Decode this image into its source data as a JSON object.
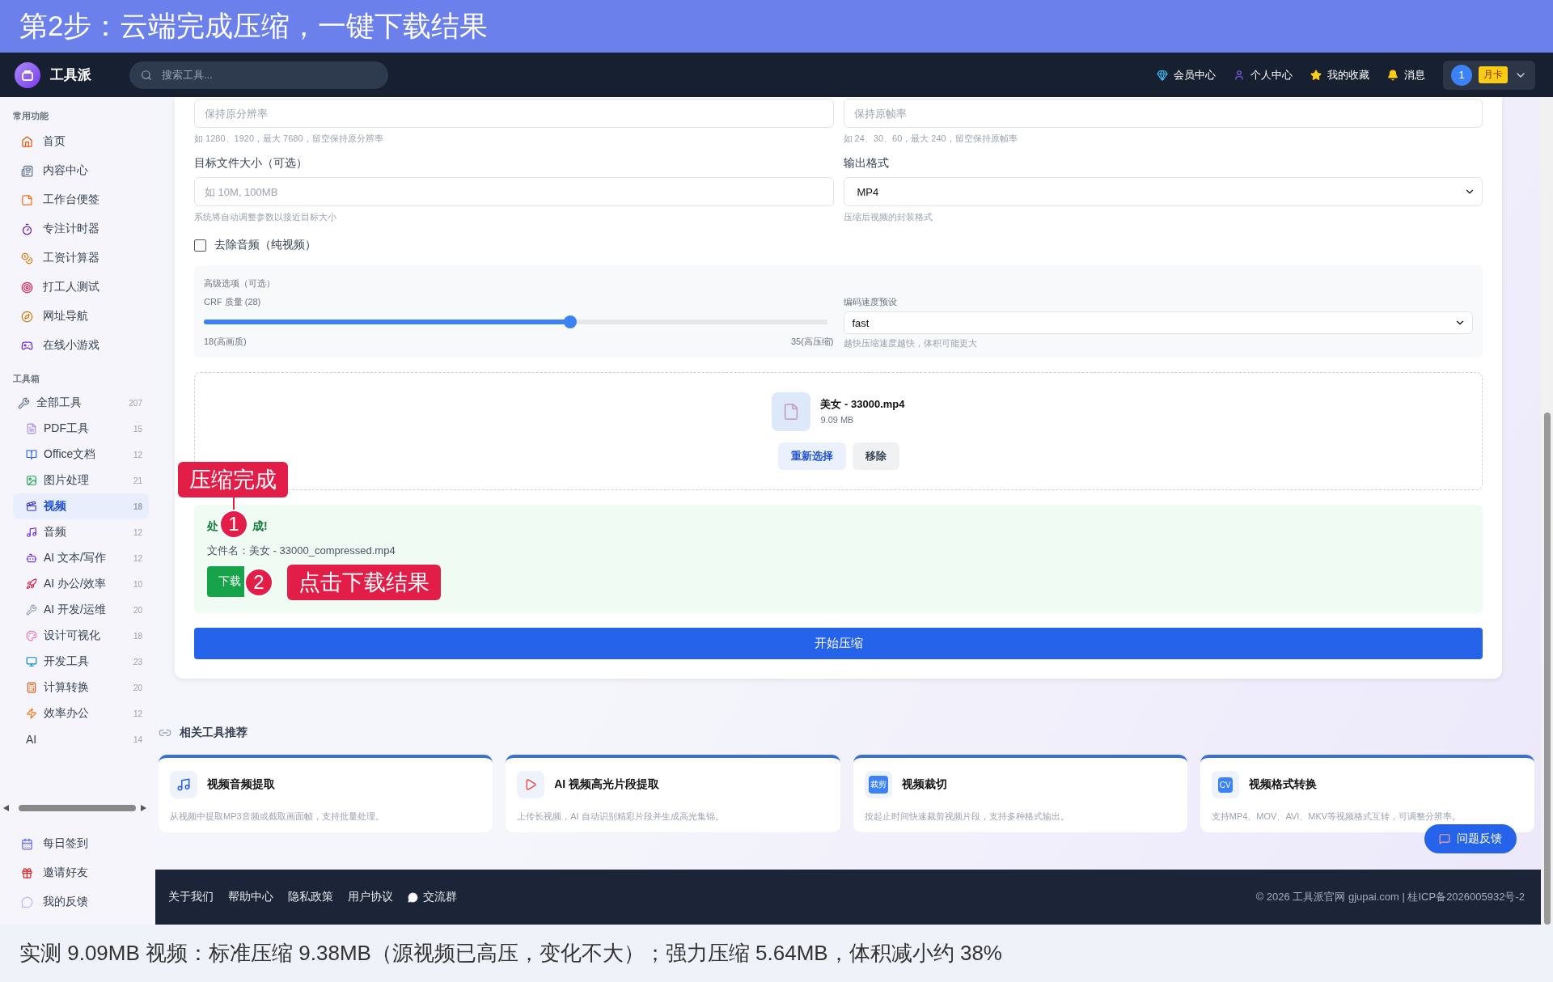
{
  "banner": {
    "title": "第2步：云端完成压缩，一键下载结果"
  },
  "header": {
    "logo": "工具派",
    "search_placeholder": "搜索工具...",
    "nav": [
      {
        "label": "会员中心"
      },
      {
        "label": "个人中心"
      },
      {
        "label": "我的收藏"
      },
      {
        "label": "消息"
      }
    ],
    "user": {
      "number": "1",
      "badge": "月卡"
    }
  },
  "sidebar": {
    "sections": [
      {
        "title": "常用功能",
        "items": [
          {
            "label": "首页",
            "selected": false
          },
          {
            "label": "内容中心",
            "selected": false
          },
          {
            "label": "工作台便签",
            "selected": false
          },
          {
            "label": "专注计时器",
            "selected": false
          },
          {
            "label": "工资计算器",
            "selected": false
          },
          {
            "label": "打工人测试",
            "selected": false
          },
          {
            "label": "网址导航",
            "selected": false
          },
          {
            "label": "在线小游戏",
            "selected": false
          }
        ]
      },
      {
        "title": "工具箱",
        "all": {
          "label": "全部工具",
          "count": "207"
        },
        "items": [
          {
            "label": "PDF工具",
            "count": "15",
            "selected": false
          },
          {
            "label": "Office文档",
            "count": "12",
            "selected": false
          },
          {
            "label": "图片处理",
            "count": "21",
            "selected": false
          },
          {
            "label": "视频",
            "count": "18",
            "selected": true
          },
          {
            "label": "音频",
            "count": "12",
            "selected": false
          },
          {
            "label": "AI 文本/写作",
            "count": "12",
            "selected": false
          },
          {
            "label": "AI 办公/效率",
            "count": "10",
            "selected": false
          },
          {
            "label": "AI 开发/运维",
            "count": "20",
            "selected": false
          },
          {
            "label": "设计可视化",
            "count": "18",
            "selected": false
          },
          {
            "label": "开发工具",
            "count": "23",
            "selected": false
          },
          {
            "label": "计算转换",
            "count": "20",
            "selected": false
          },
          {
            "label": "效率办公",
            "count": "12",
            "selected": false
          },
          {
            "label": "AI",
            "count": "14",
            "selected": false
          }
        ]
      }
    ],
    "bottom_items": [
      {
        "label": "每日签到"
      },
      {
        "label": "邀请好友"
      },
      {
        "label": "我的反馈"
      }
    ]
  },
  "form": {
    "resolution_placeholder": "保持原分辨率",
    "resolution_hint": "如 1280、1920，最大 7680，留空保持原分辨率",
    "fps_placeholder": "保持原帧率",
    "fps_hint": "如 24、30、60，最大 240，留空保持原帧率",
    "size_label": "目标文件大小（可选）",
    "size_placeholder": "如 10M, 100MB",
    "size_hint": "系统将自动调整参数以接近目标大小",
    "format_label": "输出格式",
    "format_value": "MP4",
    "format_hint": "压缩后视频的封装格式",
    "remove_audio": {
      "label": "去除音频（纯视频）",
      "checked": false
    },
    "advanced": {
      "title": "高级选项（可选）",
      "crf_label": "CRF 质量 (28)",
      "level": 0.588,
      "min_label": "18(高画质)",
      "max_label": "35(高压缩)",
      "preset_label": "编码速度预设",
      "preset_value": "fast",
      "preset_hint": "越快压缩速度越快，体积可能更大"
    }
  },
  "upload": {
    "file_name": "美女 - 33000.mp4",
    "file_size": "9.09 MB",
    "buttons": [
      {
        "label": "重新选择",
        "kind": "primary"
      },
      {
        "label": "移除",
        "kind": "plain"
      }
    ]
  },
  "result": {
    "title_start": "处",
    "title_end": "成!",
    "file_label": "文件名：美女 - 33000_compressed.mp4",
    "download_label": "下载"
  },
  "start_button": "开始压缩",
  "annotations": [
    {
      "number": "1",
      "text": "压缩完成"
    },
    {
      "number": "2",
      "text": "点击下载结果"
    }
  ],
  "related": {
    "title": "相关工具推荐",
    "cards": [
      {
        "kind": "music",
        "title": "视频音频提取",
        "description": "从视频中提取MP3音频或截取画面帧，支持批量处理。"
      },
      {
        "kind": "clip",
        "title": "AI 视频高光片段提取",
        "description": "上传长视频，AI 自动识别精彩片段并生成高光集锦。"
      },
      {
        "kind": "label",
        "icon_text": "裁剪",
        "title": "视频裁切",
        "description": "按起止时间快速裁剪视频片段，支持多种格式输出。"
      },
      {
        "kind": "label",
        "icon_text": "CV",
        "title": "视频格式转换",
        "description": "支持MP4、MOV、AVI、MKV等视频格式互转，可调整分辨率。"
      }
    ]
  },
  "feedback_button": "问题反馈",
  "footer": {
    "links": [
      "关于我们",
      "帮助中心",
      "隐私政策",
      "用户协议",
      "交流群"
    ],
    "copyright": "© 2026 工具派官网 gjupai.com | 桂ICP备2026005932号-2"
  },
  "caption": "实测 9.09MB 视频：标准压缩 9.38MB（源视频已高压，变化不大）；强力压缩 5.64MB，体积减小约 38%"
}
